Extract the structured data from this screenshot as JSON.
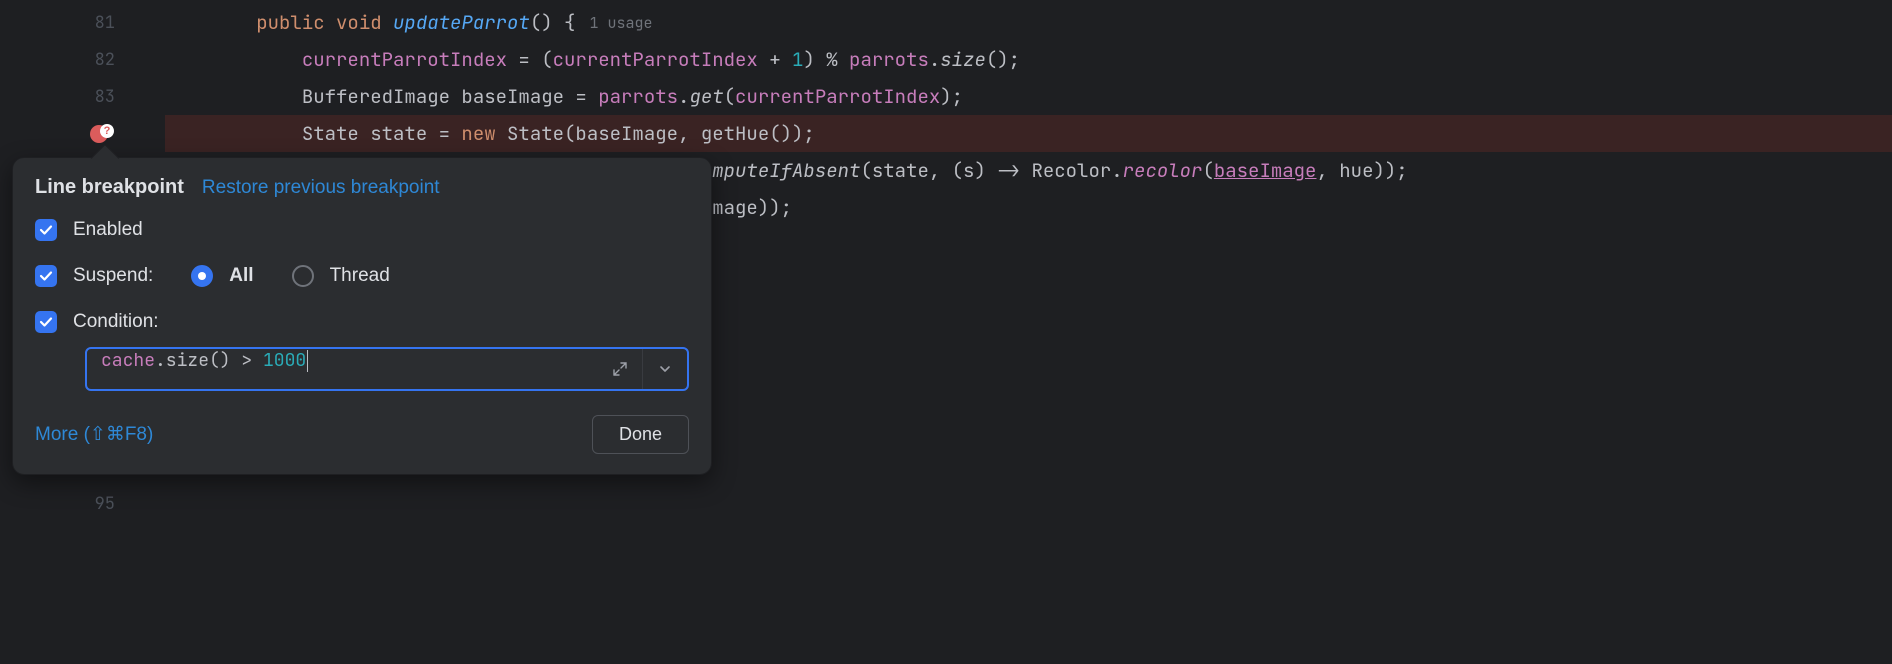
{
  "gutter": {
    "lines": [
      "81",
      "82",
      "83",
      "",
      "",
      "",
      "",
      "",
      "",
      "",
      "",
      "",
      "",
      "95"
    ]
  },
  "code": {
    "l81_public": "public",
    "l81_void": "void",
    "l81_method": "updateParrot",
    "l81_paren": "() {",
    "l81_usage": "1 usage",
    "l82": {
      "indent": "            ",
      "p1": "currentParrotIndex",
      "p2": " = (",
      "p3": "currentParrotIndex",
      "p4": " + ",
      "p5": "1",
      "p6": ") % ",
      "p7": "parrots",
      "p8": ".",
      "p9": "size",
      "p10": "();"
    },
    "l83": {
      "indent": "            ",
      "p1": "BufferedImage baseImage = ",
      "p2": "parrots",
      "p3": ".",
      "p4": "get",
      "p5": "(",
      "p6": "currentParrotIndex",
      "p7": ");"
    },
    "l84": {
      "indent": "            ",
      "p1": "State state = ",
      "p2": "new",
      "p3": " State(baseImage, getHue());"
    },
    "l85": {
      "pre": "                                             ",
      "p1": ".",
      "p2": "computeIfAbsent",
      "p3": "(state, (s) -> Recolor.",
      "p4": "recolor",
      "p5": "(",
      "p6": "baseImage",
      "p7": ", hue));"
    },
    "l86": "                                             edImage));"
  },
  "popup": {
    "title": "Line breakpoint",
    "restore_link": "Restore previous breakpoint",
    "enabled_label": "Enabled",
    "suspend_label": "Suspend:",
    "radio_all": "All",
    "radio_thread": "Thread",
    "condition_label": "Condition:",
    "condition": {
      "p1": "cache",
      "p2": ".size() > ",
      "p3": "1000"
    },
    "more_link": "More (⇧⌘F8)",
    "done_label": "Done"
  }
}
